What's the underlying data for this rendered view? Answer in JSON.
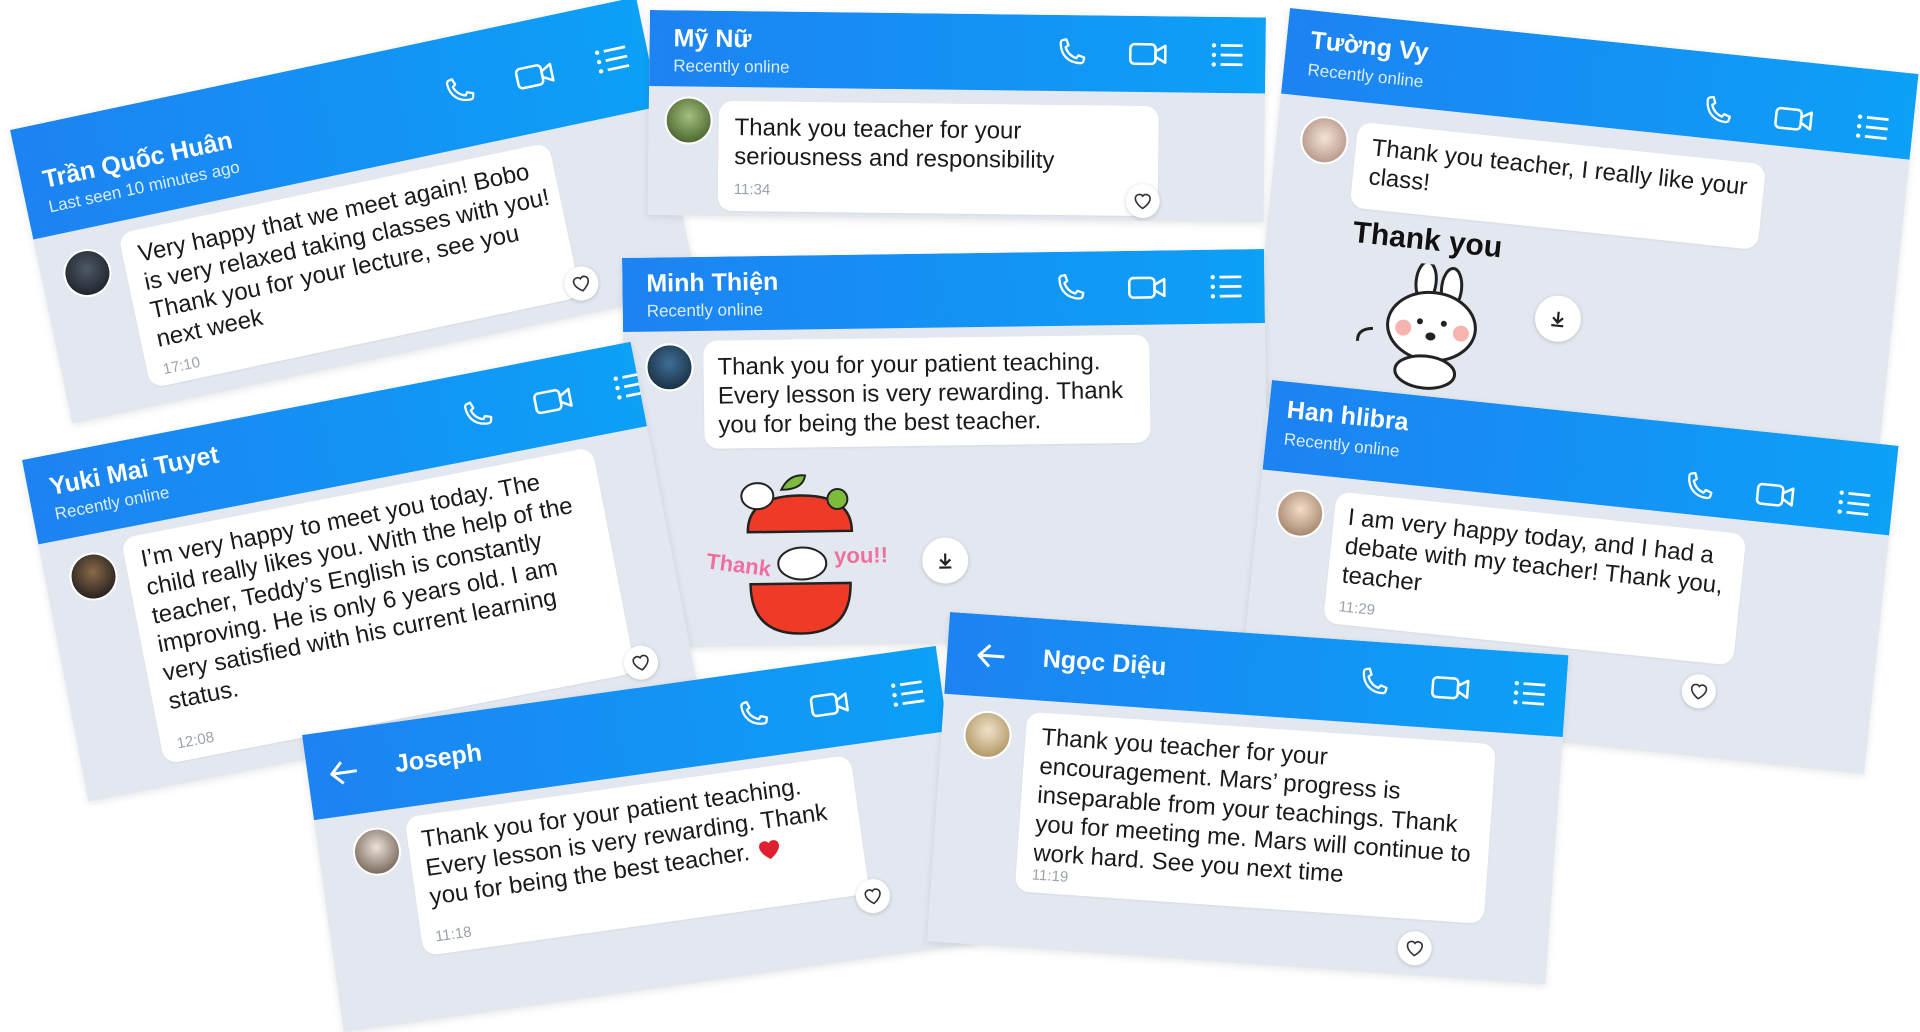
{
  "colors": {
    "header_start": "#1d83f2",
    "header_end": "#0ca0f7",
    "chat_background": "#e3e8f0",
    "bubble": "#ffffff",
    "timestamp": "#9aa2ad"
  },
  "header_icons": [
    "phone-icon",
    "video-camera-icon",
    "menu-list-icon"
  ],
  "chats": {
    "tran_quoc_huan": {
      "name": "Trần Quốc Huân",
      "status": "Last seen 10 minutes ago",
      "message": "Very happy that we meet again! Bobo is very relaxed taking classes with you! Thank you for your lecture, see you next week",
      "time": "17:10"
    },
    "my_nu": {
      "name": "Mỹ Nữ",
      "status": "Recently online",
      "message": "Thank you teacher for your seriousness and responsibility",
      "time": "11:34"
    },
    "tuong_vy": {
      "name": "Tường Vy",
      "status": "Recently online",
      "message": "Thank you teacher, I really like your class!",
      "sticker_text": "Thank you"
    },
    "minh_thien": {
      "name": "Minh Thiện",
      "status": "Recently online",
      "message": "Thank you for your patient teaching. Every lesson is very rewarding. Thank you for being the best teacher.",
      "sticker_text_left": "Thank",
      "sticker_text_right": "you!!"
    },
    "yuki_mai_tuyet": {
      "name": "Yuki Mai Tuyet",
      "status": "Recently online",
      "message": "I’m very happy to meet you today. The child really likes you. With the help of the teacher, Teddy’s English is constantly improving. He is only 6 years old. I am very satisfied with his current learning status.",
      "time": "12:08"
    },
    "han_hlibra": {
      "name": "Han hlibra",
      "status": "Recently online",
      "message": "I am very happy today, and I had a debate with my teacher! Thank you, teacher",
      "time": "11:29"
    },
    "joseph": {
      "name": "Joseph",
      "message": "Thank you for your patient teaching. Every lesson is very rewarding. Thank you for being the best teacher.",
      "time": "11:18"
    },
    "ngoc_dieu": {
      "name": "Ngọc Diệu",
      "message": "Thank you teacher for your encouragement. Mars’ progress is inseparable from your teachings. Thank you for meeting me. Mars will continue to work hard. See you next time",
      "time": "11:19"
    }
  }
}
